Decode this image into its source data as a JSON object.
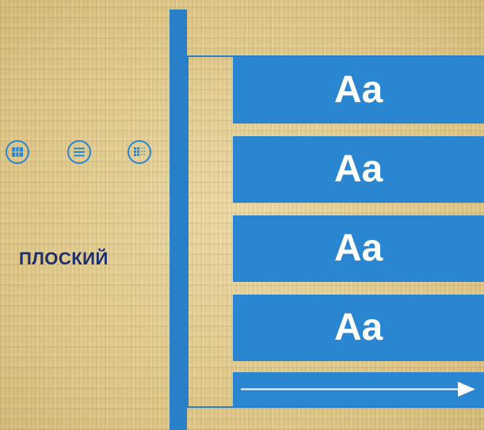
{
  "view_icons": [
    {
      "name": "grid-view-icon"
    },
    {
      "name": "list-view-icon"
    },
    {
      "name": "dots-view-icon"
    }
  ],
  "mode_label": "ПЛОСКИЙ",
  "items": [
    "Aa",
    "Aa",
    "Aa",
    "Aa"
  ],
  "colors": {
    "accent": "#2a86d0",
    "bar": "#2a7fc9",
    "label": "#1c2e6e",
    "background": "#e3cf95"
  }
}
